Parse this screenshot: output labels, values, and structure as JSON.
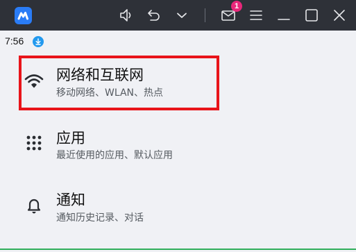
{
  "window": {
    "title_bar_color": "#2e3138",
    "logo_color": "#2a7cf6",
    "notification_count": "1",
    "icons": [
      "app-logo",
      "speaker-icon",
      "undo-icon",
      "chevron-down-icon",
      "mail-icon",
      "menu-icon",
      "minimize-icon",
      "maximize-icon",
      "close-icon"
    ]
  },
  "status": {
    "time": "7:56"
  },
  "settings": {
    "items": [
      {
        "title": "网络和互联网",
        "subtitle": "移动网络、WLAN、热点",
        "icon": "wifi-icon"
      },
      {
        "title": "应用",
        "subtitle": "最近使用的应用、默认应用",
        "icon": "apps-grid-icon"
      },
      {
        "title": "通知",
        "subtitle": "通知历史记录、对话",
        "icon": "bell-icon"
      }
    ],
    "highlight_color": "#e8141a"
  }
}
